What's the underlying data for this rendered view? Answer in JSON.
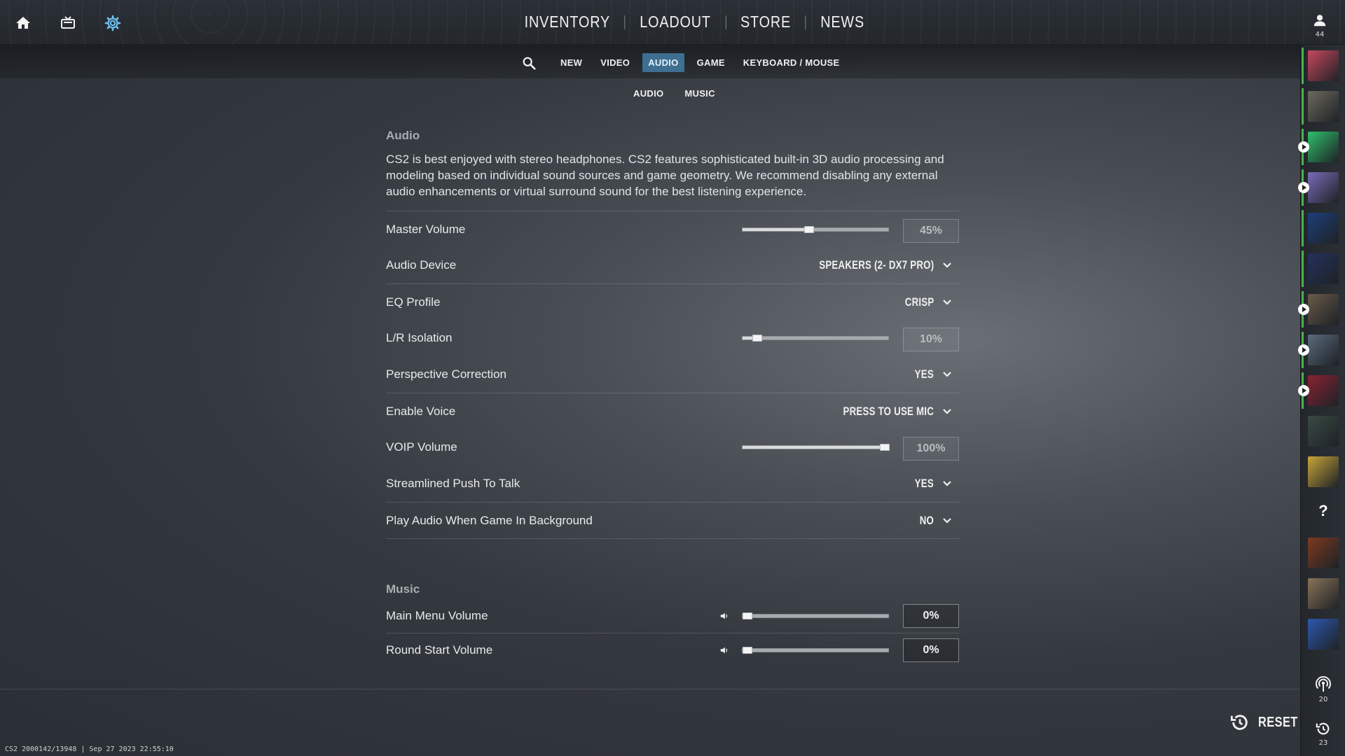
{
  "top_nav": {
    "icons": [
      "home-icon",
      "tv-icon",
      "gear-icon"
    ],
    "items": [
      "INVENTORY",
      "LOADOUT",
      "STORE",
      "NEWS"
    ],
    "profile_count": "44"
  },
  "sub_nav": {
    "tabs": [
      "NEW",
      "VIDEO",
      "AUDIO",
      "GAME",
      "KEYBOARD / MOUSE"
    ],
    "active_tab": "AUDIO",
    "sub_tabs": [
      "AUDIO",
      "MUSIC"
    ]
  },
  "audio": {
    "title": "Audio",
    "description": "CS2 is best enjoyed with stereo headphones. CS2 features sophisticated built-in 3D audio processing and modeling based on individual sound sources and game geometry. We recommend disabling any external audio enhancements or virtual surround sound for the best listening experience.",
    "rows": [
      {
        "label": "Master Volume",
        "type": "slider",
        "value": "45%",
        "level": 0.45
      },
      {
        "label": "Audio Device",
        "type": "dropdown",
        "value": "SPEAKERS (2- DX7 PRO)"
      },
      {
        "label": "EQ Profile",
        "type": "dropdown",
        "value": "CRISP"
      },
      {
        "label": "L/R Isolation",
        "type": "slider",
        "value": "10%",
        "level": 0.1
      },
      {
        "label": "Perspective Correction",
        "type": "dropdown",
        "value": "YES"
      },
      {
        "label": "Enable Voice",
        "type": "dropdown",
        "value": "PRESS TO USE MIC"
      },
      {
        "label": "VOIP Volume",
        "type": "slider",
        "value": "100%",
        "level": 1.0
      },
      {
        "label": "Streamlined Push To Talk",
        "type": "dropdown",
        "value": "YES"
      },
      {
        "label": "Play Audio When Game In Background",
        "type": "dropdown",
        "value": "NO"
      }
    ]
  },
  "music": {
    "title": "Music",
    "rows": [
      {
        "label": "Main Menu Volume",
        "value": "0%",
        "level": 0
      },
      {
        "label": "Round Start Volume",
        "value": "0%",
        "level": 0
      }
    ]
  },
  "footer": {
    "reset_label": "RESET",
    "build_info": "CS2 2000142/13948 | Sep 27 2023 22:55:10"
  },
  "friends_rail": {
    "broadcast_count": "20",
    "history_count": "23",
    "help_label": "?",
    "avatar_colors": [
      "#c7475e",
      "#6d6a5e",
      "#2fbf6b",
      "#7a6bb8",
      "#1d3e7a",
      "#24315c",
      "#6b5a4a",
      "#5b6a7c",
      "#8a2233",
      "#3a4a44",
      "#c8a43a",
      "#7d3a1f",
      "#8a7358",
      "#2d58b0"
    ]
  }
}
